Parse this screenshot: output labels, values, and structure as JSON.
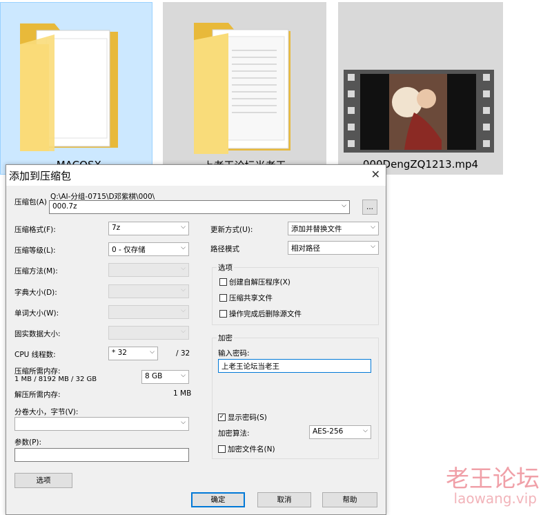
{
  "explorer": {
    "items": [
      {
        "label": "_MACOSX"
      },
      {
        "label": "上老王论坛当老王"
      },
      {
        "label": "000DengZQ1213.mp4"
      }
    ]
  },
  "dialog": {
    "title": "添加到压缩包",
    "close_glyph": "✕",
    "archive": {
      "label": "压缩包(A)",
      "path": "Q:\\AI-分组-0715\\D邓紫棋\\000\\",
      "value": "000.7z",
      "browse_label": "..."
    },
    "left": {
      "format": {
        "label": "压缩格式(F):",
        "value": "7z"
      },
      "level": {
        "label": "压缩等级(L):",
        "value": "0 - 仅存储"
      },
      "method": {
        "label": "压缩方法(M):",
        "value": ""
      },
      "dict": {
        "label": "字典大小(D):",
        "value": ""
      },
      "word": {
        "label": "单词大小(W):",
        "value": ""
      },
      "solid": {
        "label": "固实数据大小:",
        "value": ""
      },
      "threads": {
        "label": "CPU 线程数:",
        "value": "* 32",
        "max": "/ 32"
      },
      "mem_comp": {
        "label": "压缩所需内存:",
        "detail": "1 MB / 8192 MB / 32 GB",
        "value": "8 GB"
      },
      "mem_decomp": {
        "label": "解压所需内存:",
        "value": "1 MB"
      },
      "volume": {
        "label": "分卷大小，字节(V):",
        "value": ""
      },
      "params": {
        "label": "参数(P):",
        "value": ""
      },
      "options_btn": "选项"
    },
    "right": {
      "update": {
        "label": "更新方式(U):",
        "value": "添加并替换文件"
      },
      "path_mode": {
        "label": "路径模式",
        "value": "相对路径"
      },
      "options_group": {
        "title": "选项",
        "sfx": {
          "label": "创建自解压程序(X)",
          "checked": false
        },
        "shared": {
          "label": "压缩共享文件",
          "checked": false
        },
        "delete": {
          "label": "操作完成后删除源文件",
          "checked": false
        }
      },
      "encrypt_group": {
        "title": "加密",
        "password_label": "输入密码:",
        "password_value": "上老王论坛当老王",
        "show_password": {
          "label": "显示密码(S)",
          "checked": true
        },
        "method_label": "加密算法:",
        "method_value": "AES-256",
        "encrypt_names": {
          "label": "加密文件名(N)",
          "checked": false
        }
      }
    },
    "buttons": {
      "ok": "确定",
      "cancel": "取消",
      "help": "帮助"
    }
  },
  "watermark": {
    "cn": "老王论坛",
    "en": "laowang.vip"
  },
  "glyphs": {
    "dropdown": "⌵",
    "check": "✓"
  }
}
